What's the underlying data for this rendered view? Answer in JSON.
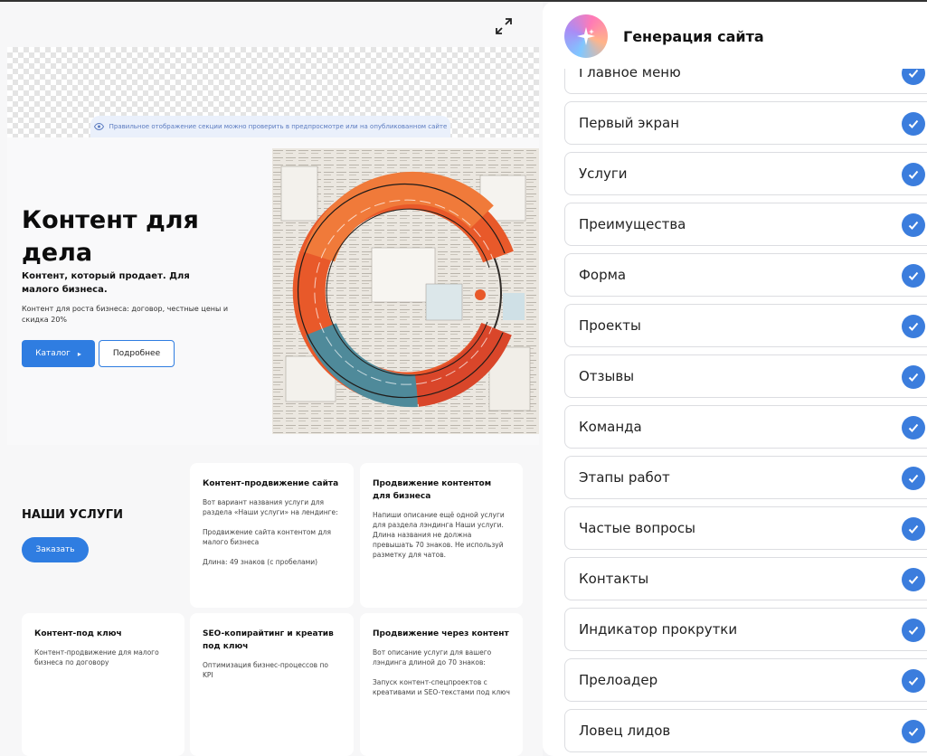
{
  "preview": {
    "notice": "Правильное отображение секции можно проверить в предпросмотре или на опубликованном сайте",
    "hero": {
      "title": "Контент для дела",
      "subtitle": "Контент, который продает. Для малого бизнеса.",
      "description": "Контент для роста бизнеса: договор, честные цены и скидка 20%",
      "catalog_button": "Каталог",
      "more_button": "Подробнее"
    },
    "services": {
      "heading": "НАШИ УСЛУГИ",
      "order_button": "Заказать",
      "cards": [
        {
          "title": "Контент-продвижение сайта",
          "text": "Вот вариант названия услуги для раздела «Наши услуги» на лендинге:\n\nПродвижение сайта контентом для малого бизнеса\n\nДлина: 49 знаков (с пробелами)"
        },
        {
          "title": "Продвижение контентом для бизнеса",
          "text": "Напиши описание ещё одной услуги для раздела лэндинга Наши услуги. Длина названия не должна превышать 70 знаков. Не используй разметку для чатов."
        },
        {
          "title": "Контент-под ключ",
          "text": "Контент-продвижение для малого бизнеса по договору"
        },
        {
          "title": "SEO-копирайтинг и креатив под ключ",
          "text": "Оптимизация бизнес-процессов по KPI"
        },
        {
          "title": "Продвижение через контент",
          "text": "Вот описание услуги для вашего лэндинга длиной до 70 знаков:\n\nЗапуск контент-спецпроектов с креативами и SEO-текстами под ключ"
        }
      ]
    }
  },
  "panel": {
    "title": "Генерация сайта",
    "items": [
      {
        "label": "Главное меню"
      },
      {
        "label": "Первый экран"
      },
      {
        "label": "Услуги"
      },
      {
        "label": "Преимущества"
      },
      {
        "label": "Форма"
      },
      {
        "label": "Проекты"
      },
      {
        "label": "Отзывы"
      },
      {
        "label": "Команда"
      },
      {
        "label": "Этапы работ"
      },
      {
        "label": "Частые вопросы"
      },
      {
        "label": "Контакты"
      },
      {
        "label": "Индикатор прокрутки"
      },
      {
        "label": "Прелоадер"
      },
      {
        "label": "Ловец лидов"
      }
    ]
  },
  "colors": {
    "accent": "#2f7de1",
    "check": "#3b7ddd",
    "hero_orange": "#e85a2a",
    "hero_teal": "#4f8a9a"
  },
  "icons": {
    "expand": "expand-icon",
    "eye": "eye-icon",
    "sparkle": "sparkle-icon",
    "check": "check-icon",
    "arrow": "chevron-right-icon"
  }
}
